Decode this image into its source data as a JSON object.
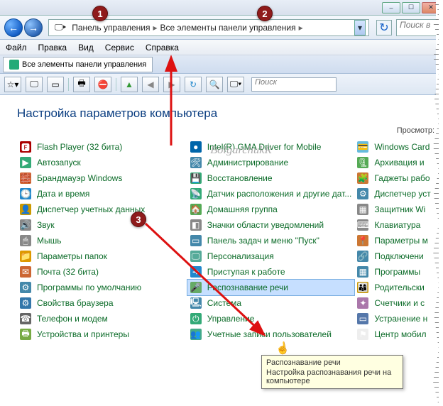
{
  "window": {
    "min": "–",
    "max": "☐",
    "close": "✕"
  },
  "nav": {
    "back": "←",
    "fwd": "→",
    "segments": [
      "Панель управления",
      "Все элементы панели управления"
    ],
    "sep": "▸",
    "refresh": "↻",
    "search_placeholder": "Поиск в"
  },
  "menu": [
    "Файл",
    "Правка",
    "Вид",
    "Сервис",
    "Справка"
  ],
  "tab": {
    "label": "Все элементы панели управления"
  },
  "toolbar": {
    "search_placeholder": "Поиск",
    "icons": [
      "⚙",
      "🖵",
      "⬚",
      "🖶",
      "✖",
      "",
      "⯈",
      "⯇",
      "↻",
      "🔍",
      "🖵"
    ]
  },
  "heading": "Настройка параметров компьютера",
  "view_label": "Просмотр:",
  "watermark": "BolgarchukR",
  "callouts": [
    "1",
    "2",
    "3"
  ],
  "columns": [
    [
      {
        "icon": "🅵",
        "bg": "#a00",
        "label": "Flash Player (32 бита)"
      },
      {
        "icon": "▶",
        "bg": "#3a7",
        "label": "Автозапуск"
      },
      {
        "icon": "🧱",
        "bg": "#c63",
        "label": "Брандмауэр Windows"
      },
      {
        "icon": "🕒",
        "bg": "#28c",
        "label": "Дата и время"
      },
      {
        "icon": "👤",
        "bg": "#c90",
        "label": "Диспетчер учетных данных"
      },
      {
        "icon": "🔊",
        "bg": "#888",
        "label": "Звук"
      },
      {
        "icon": "🖱",
        "bg": "#888",
        "label": "Мышь"
      },
      {
        "icon": "📁",
        "bg": "#d90",
        "label": "Параметры папок"
      },
      {
        "icon": "✉",
        "bg": "#c63",
        "label": "Почта (32 бита)"
      },
      {
        "icon": "⚙",
        "bg": "#48a",
        "label": "Программы по умолчанию"
      },
      {
        "icon": "⚙",
        "bg": "#37a",
        "label": "Свойства браузера"
      },
      {
        "icon": "☎",
        "bg": "#666",
        "label": "Телефон и модем"
      },
      {
        "icon": "🖶",
        "bg": "#7a4",
        "label": "Устройства и принтеры"
      }
    ],
    [
      {
        "icon": "●",
        "bg": "#06a",
        "label": "Intel(R) GMA Driver for Mobile"
      },
      {
        "icon": "🛠",
        "bg": "#48a",
        "label": "Администрирование"
      },
      {
        "icon": "💾",
        "bg": "#3a7",
        "label": "Восстановление"
      },
      {
        "icon": "📡",
        "bg": "#3a7",
        "label": "Датчик расположения и другие дат..."
      },
      {
        "icon": "🏠",
        "bg": "#5a5",
        "label": "Домашняя группа"
      },
      {
        "icon": "◧",
        "bg": "#888",
        "label": "Значки области уведомлений"
      },
      {
        "icon": "▭",
        "bg": "#48a",
        "label": "Панель задач и меню \"Пуск\""
      },
      {
        "icon": "🖵",
        "bg": "#5a9",
        "label": "Персонализация"
      },
      {
        "icon": "➜",
        "bg": "#28c",
        "label": "Приступая к работе"
      },
      {
        "icon": "🎤",
        "bg": "#6a6",
        "label": "Распознавание речи",
        "selected": true
      },
      {
        "icon": "🖳",
        "bg": "#48a",
        "label": "Система"
      },
      {
        "icon": "⏻",
        "bg": "#3a7",
        "label": "Управление"
      },
      {
        "icon": "👥",
        "bg": "#4a8",
        "label": "Учетные записи пользователей"
      }
    ],
    [
      {
        "icon": "💳",
        "bg": "#6bd",
        "label": "Windows Card"
      },
      {
        "icon": "🗜",
        "bg": "#5a5",
        "label": "Архивация и"
      },
      {
        "icon": "🧩",
        "bg": "#c73",
        "label": "Гаджеты рабо"
      },
      {
        "icon": "⚙",
        "bg": "#48a",
        "label": "Диспетчер уст"
      },
      {
        "icon": "▦",
        "bg": "#888",
        "label": "Защитник Wi"
      },
      {
        "icon": "⌨",
        "bg": "#888",
        "label": "Клавиатура"
      },
      {
        "icon": "📍",
        "bg": "#c73",
        "label": "Параметры м"
      },
      {
        "icon": "🔗",
        "bg": "#48a",
        "label": "Подключени"
      },
      {
        "icon": "▦",
        "bg": "#48a",
        "label": "Программы"
      },
      {
        "icon": "👨‍👩‍👦",
        "bg": "#c90",
        "label": "Родительски"
      },
      {
        "icon": "✦",
        "bg": "#a7a",
        "label": "Счетчики и с"
      },
      {
        "icon": "▭",
        "bg": "#57a",
        "label": "Устранение н"
      },
      {
        "icon": "⚑",
        "bg": "#eee",
        "label": "Центр мобил"
      }
    ]
  ],
  "tooltip": {
    "title": "Распознавание речи",
    "body": "Настройка распознавания речи на компьютере"
  },
  "cursor_glyph": "☝"
}
